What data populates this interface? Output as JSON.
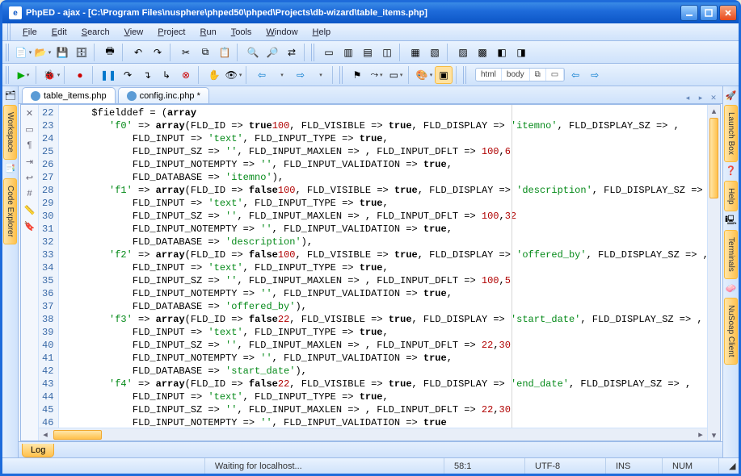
{
  "window": {
    "title": "PhpED - ajax - [C:\\Program Files\\nusphere\\phped50\\phped\\Projects\\db-wizard\\table_items.php]"
  },
  "menu": [
    "File",
    "Edit",
    "Search",
    "View",
    "Project",
    "Run",
    "Tools",
    "Window",
    "Help"
  ],
  "tabs": [
    {
      "name": "table_items.php",
      "active": true
    },
    {
      "name": "config.inc.php *",
      "active": false
    }
  ],
  "left_dock": [
    "Workspace",
    "Code Explorer"
  ],
  "right_dock": [
    "Launch Box",
    "Help",
    "Terminals",
    "NuSoap Client"
  ],
  "breadcrumb": [
    "html",
    "body"
  ],
  "log_tab": "Log",
  "status": {
    "message": "Waiting for localhost...",
    "pos": "58:1",
    "encoding": "UTF-8",
    "ins": "INS",
    "num": "NUM"
  },
  "first_line_no": 22,
  "code_lines": [
    {
      "t": "     $fielddef = ",
      "k": "array",
      "r": "("
    },
    {
      "t": "        ",
      "s": "'f0'",
      "r": " => ",
      "k": "array",
      "r2": "(FLD_ID => ",
      "k2": "true",
      "r3": ", FLD_VISIBLE => ",
      "k3": "true",
      "r4": ", FLD_DISPLAY => ",
      "s2": "'itemno'",
      "r5": ", FLD_DISPLAY_SZ => ",
      "n": "100",
      "r6": ","
    },
    {
      "t": "            FLD_INPUT => ",
      "k": "true",
      "r": ", FLD_INPUT_TYPE => ",
      "s": "'text'",
      "r2": ","
    },
    {
      "t": "            FLD_INPUT_SZ => ",
      "n": "100",
      "r": ", FLD_INPUT_MAXLEN => ",
      "n2": "6",
      "r2": ", FLD_INPUT_DFLT => ",
      "s": "''",
      "r3": ","
    },
    {
      "t": "            FLD_INPUT_NOTEMPTY => ",
      "k": "true",
      "r": ", FLD_INPUT_VALIDATION => ",
      "s": "''",
      "r2": ","
    },
    {
      "t": "            FLD_DATABASE => ",
      "s": "'itemno'",
      "r": "),"
    },
    {
      "t": "        ",
      "s": "'f1'",
      "r": " => ",
      "k": "array",
      "r2": "(FLD_ID => ",
      "k2": "false",
      "r3": ", FLD_VISIBLE => ",
      "k3": "true",
      "r4": ", FLD_DISPLAY => ",
      "s2": "'description'",
      "r5": ", FLD_DISPLAY_SZ => ",
      "n": "100",
      "r6": ","
    },
    {
      "t": "            FLD_INPUT => ",
      "k": "true",
      "r": ", FLD_INPUT_TYPE => ",
      "s": "'text'",
      "r2": ","
    },
    {
      "t": "            FLD_INPUT_SZ => ",
      "n": "100",
      "r": ", FLD_INPUT_MAXLEN => ",
      "n2": "32",
      "r2": ", FLD_INPUT_DFLT => ",
      "s": "''",
      "r3": ","
    },
    {
      "t": "            FLD_INPUT_NOTEMPTY => ",
      "k": "true",
      "r": ", FLD_INPUT_VALIDATION => ",
      "s": "''",
      "r2": ","
    },
    {
      "t": "            FLD_DATABASE => ",
      "s": "'description'",
      "r": "),"
    },
    {
      "t": "        ",
      "s": "'f2'",
      "r": " => ",
      "k": "array",
      "r2": "(FLD_ID => ",
      "k2": "false",
      "r3": ", FLD_VISIBLE => ",
      "k3": "true",
      "r4": ", FLD_DISPLAY => ",
      "s2": "'offered_by'",
      "r5": ", FLD_DISPLAY_SZ => ",
      "n": "100",
      "r6": ","
    },
    {
      "t": "            FLD_INPUT => ",
      "k": "true",
      "r": ", FLD_INPUT_TYPE => ",
      "s": "'text'",
      "r2": ","
    },
    {
      "t": "            FLD_INPUT_SZ => ",
      "n": "100",
      "r": ", FLD_INPUT_MAXLEN => ",
      "n2": "5",
      "r2": ", FLD_INPUT_DFLT => ",
      "s": "''",
      "r3": ","
    },
    {
      "t": "            FLD_INPUT_NOTEMPTY => ",
      "k": "true",
      "r": ", FLD_INPUT_VALIDATION => ",
      "s": "''",
      "r2": ","
    },
    {
      "t": "            FLD_DATABASE => ",
      "s": "'offered_by'",
      "r": "),"
    },
    {
      "t": "        ",
      "s": "'f3'",
      "r": " => ",
      "k": "array",
      "r2": "(FLD_ID => ",
      "k2": "false",
      "r3": ", FLD_VISIBLE => ",
      "k3": "true",
      "r4": ", FLD_DISPLAY => ",
      "s2": "'start_date'",
      "r5": ", FLD_DISPLAY_SZ => ",
      "n": "22",
      "r6": ","
    },
    {
      "t": "            FLD_INPUT => ",
      "k": "true",
      "r": ", FLD_INPUT_TYPE => ",
      "s": "'text'",
      "r2": ","
    },
    {
      "t": "            FLD_INPUT_SZ => ",
      "n": "22",
      "r": ", FLD_INPUT_MAXLEN => ",
      "n2": "30",
      "r2": ", FLD_INPUT_DFLT => ",
      "s": "''",
      "r3": ","
    },
    {
      "t": "            FLD_INPUT_NOTEMPTY => ",
      "k": "true",
      "r": ", FLD_INPUT_VALIDATION => ",
      "s": "''",
      "r2": ","
    },
    {
      "t": "            FLD_DATABASE => ",
      "s": "'start_date'",
      "r": "),"
    },
    {
      "t": "        ",
      "s": "'f4'",
      "r": " => ",
      "k": "array",
      "r2": "(FLD_ID => ",
      "k2": "false",
      "r3": ", FLD_VISIBLE => ",
      "k3": "true",
      "r4": ", FLD_DISPLAY => ",
      "s2": "'end_date'",
      "r5": ", FLD_DISPLAY_SZ => ",
      "n": "22",
      "r6": ","
    },
    {
      "t": "            FLD_INPUT => ",
      "k": "true",
      "r": ", FLD_INPUT_TYPE => ",
      "s": "'text'",
      "r2": ","
    },
    {
      "t": "            FLD_INPUT_SZ => ",
      "n": "22",
      "r": ", FLD_INPUT_MAXLEN => ",
      "n2": "30",
      "r2": ", FLD_INPUT_DFLT => ",
      "s": "''",
      "r3": ","
    },
    {
      "t": "            FLD_INPUT_NOTEMPTY => ",
      "k": "true",
      "r": ", FLD_INPUT_VALIDATION => ",
      "s": "''",
      "r2": ""
    }
  ]
}
